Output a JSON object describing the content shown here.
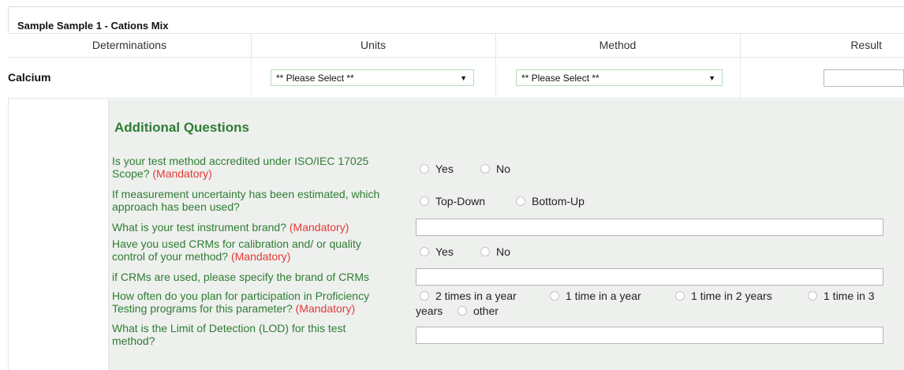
{
  "sample": {
    "title": "Sample Sample 1 - Cations Mix"
  },
  "table": {
    "headers": [
      "Determinations",
      "Units",
      "Method",
      "Result"
    ],
    "determination": "Calcium",
    "units_select": "** Please Select **",
    "method_select": "** Please Select **",
    "result_value": ""
  },
  "additional": {
    "title": "Additional Questions",
    "mandatory": "(Mandatory)",
    "q1": {
      "line1": "Is your test method accredited under ISO/IEC 17025",
      "line2": "Scope?",
      "options": [
        "Yes",
        "No"
      ]
    },
    "q2": {
      "line1": "If measurement uncertainty has been estimated, which",
      "line2": "approach has been used?",
      "options": [
        "Top-Down",
        "Bottom-Up"
      ]
    },
    "q3": {
      "text": "What is your test instrument brand?"
    },
    "q4": {
      "line1": "Have you used CRMs for calibration and/ or quality",
      "line2": "control of your method?",
      "options": [
        "Yes",
        "No"
      ]
    },
    "q5": {
      "text": "if CRMs are used, please specify the brand of CRMs"
    },
    "q6": {
      "line1": "How often do you plan for participation in Proficiency",
      "line2": "Testing programs for this parameter?",
      "options": [
        "2 times in a year",
        "1 time in a year",
        "1 time in 2 years",
        "1 time in 3",
        "years",
        "other"
      ]
    },
    "q7": {
      "line1": "What is the Limit of Detection (LOD) for this test",
      "line2": "method?"
    }
  }
}
